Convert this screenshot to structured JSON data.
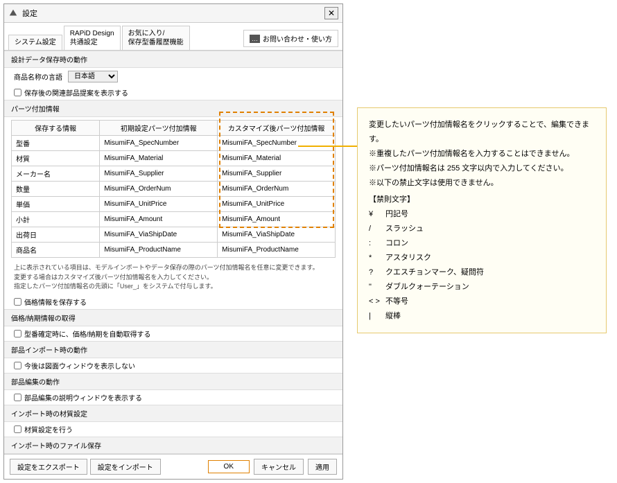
{
  "titlebar": {
    "title": "設定"
  },
  "tabs": [
    {
      "label": "システム設定"
    },
    {
      "label": "RAPiD Design\n共通設定"
    },
    {
      "label": "お気に入り/\n保存型番履歴機能"
    }
  ],
  "help_button": "お問い合わせ・使い方",
  "sections": {
    "save_behavior": "設計データ保存時の動作",
    "parts_info": "パーツ付加情報",
    "price_info": "価格/納期情報の取得",
    "import_behavior": "部品インポート時の動作",
    "edit_behavior": "部品編集の動作",
    "material_setting": "インポート時の材質設定",
    "file_save": "インポート時のファイル保存"
  },
  "labels": {
    "lang_label": "商品名称の言語",
    "lang_value": "日本語",
    "show_related": "保存後の関連部品提案を表示する",
    "save_price": "価格情報を保存する",
    "auto_fetch": "型番確定時に、価格/納期を自動取得する",
    "hide_drawing": "今後は図面ウィンドウを表示しない",
    "show_edit_help": "部品編集の説明ウィンドウを表示する",
    "do_material": "材質設定を行う"
  },
  "table": {
    "headers": {
      "save": "保存する情報",
      "default": "初期設定パーツ付加情報",
      "custom": "カスタマイズ後パーツ付加情報"
    },
    "rows": [
      {
        "save": "型番",
        "def": "MisumiFA_SpecNumber",
        "cust": "MisumiFA_SpecNumber"
      },
      {
        "save": "材質",
        "def": "MisumiFA_Material",
        "cust": "MisumiFA_Material"
      },
      {
        "save": "メーカー名",
        "def": "MisumiFA_Supplier",
        "cust": "MisumiFA_Supplier"
      },
      {
        "save": "数量",
        "def": "MisumiFA_OrderNum",
        "cust": "MisumiFA_OrderNum"
      },
      {
        "save": "単価",
        "def": "MisumiFA_UnitPrice",
        "cust": "MisumiFA_UnitPrice"
      },
      {
        "save": "小計",
        "def": "MisumiFA_Amount",
        "cust": "MisumiFA_Amount"
      },
      {
        "save": "出荷日",
        "def": "MisumiFA_ViaShipDate",
        "cust": "MisumiFA_ViaShipDate"
      },
      {
        "save": "商品名",
        "def": "MisumiFA_ProductName",
        "cust": "MisumiFA_ProductName"
      }
    ]
  },
  "table_note": {
    "l1": "上に表示されている項目は、モデルインボートやデータ保存の際のパーツ付加情報名を任意に変更できます。",
    "l2": "変更する場合はカスタマイズ後パーツ付加情報名を入力してください。",
    "l3": "指定したパーツ付加情報名の先頭に「User_」をシステムで付与します。"
  },
  "footer": {
    "export": "設定をエクスポート",
    "import": "設定をインポート",
    "ok": "OK",
    "cancel": "キャンセル",
    "apply": "適用"
  },
  "callout": {
    "l1": "変更したいパーツ付加情報名をクリックすることで、編集できます。",
    "l2": "※重複したパーツ付加情報名を入力することはできません。",
    "l3": "※パーツ付加情報名は 255 文字以内で入力してください。",
    "l4": "※以下の禁止文字は使用できません。",
    "forbidden_title": "【禁則文字】",
    "forbidden": [
      {
        "sym": "¥",
        "desc": "円記号"
      },
      {
        "sym": "/",
        "desc": "スラッシュ"
      },
      {
        "sym": ":",
        "desc": "コロン"
      },
      {
        "sym": "*",
        "desc": "アスタリスク"
      },
      {
        "sym": "?",
        "desc": "クエスチョンマーク、疑問符"
      },
      {
        "sym": "\"",
        "desc": "ダブルクォーテーション"
      },
      {
        "sym": "< >",
        "desc": "不等号"
      },
      {
        "sym": "|",
        "desc": "縦棒"
      }
    ]
  }
}
